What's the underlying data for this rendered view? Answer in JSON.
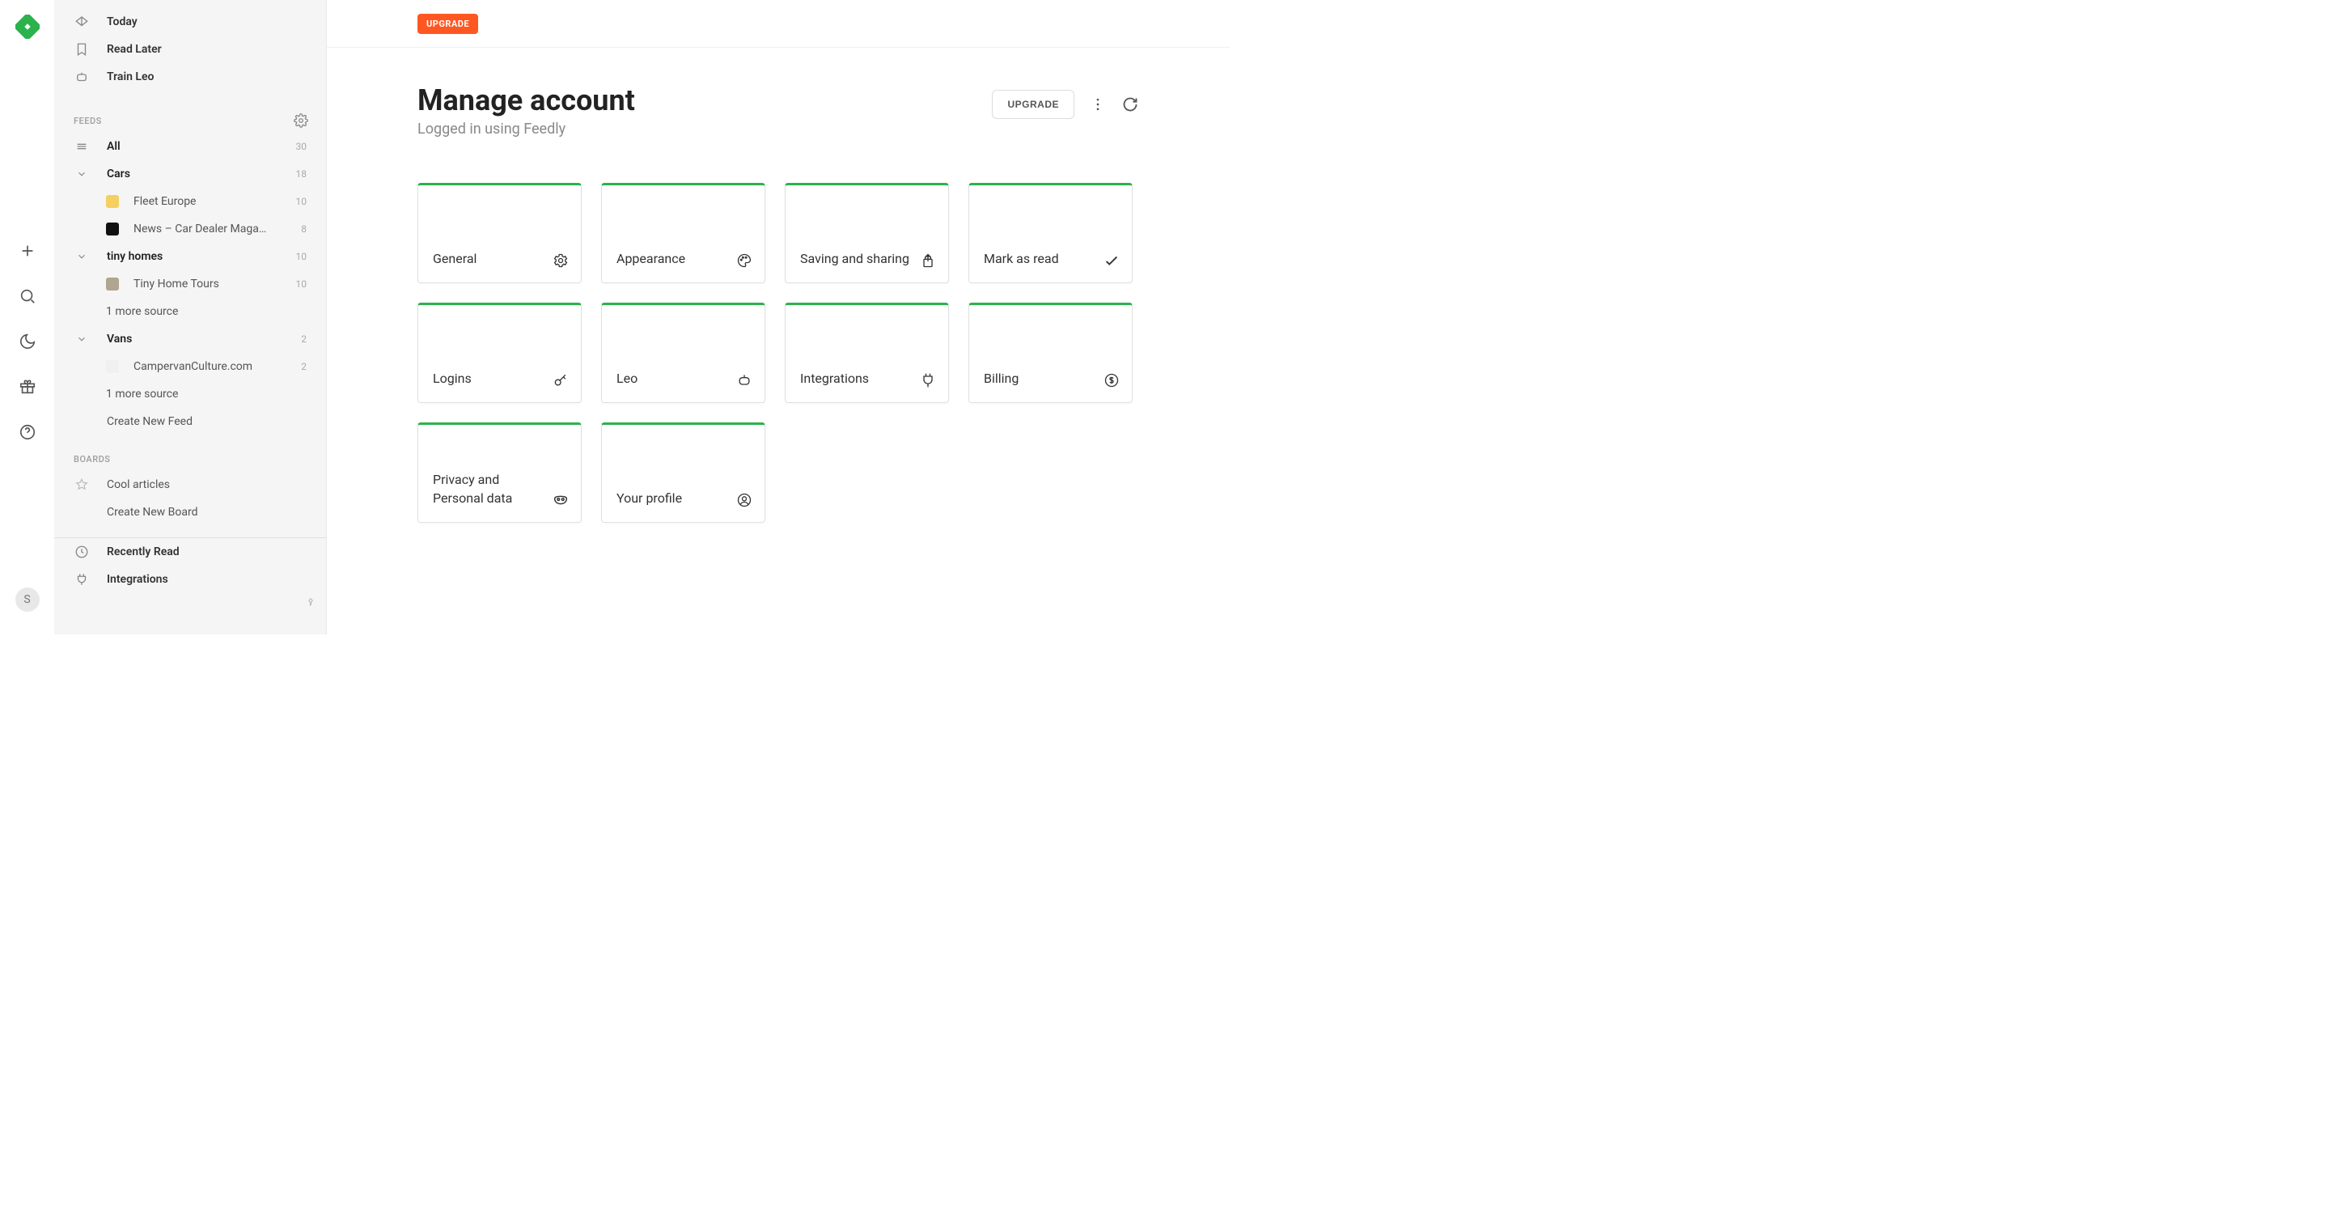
{
  "rail": {
    "avatar_letter": "S"
  },
  "sidebar": {
    "nav": {
      "today": "Today",
      "read_later": "Read Later",
      "train_leo": "Train Leo"
    },
    "feeds_label": "FEEDS",
    "all": {
      "label": "All",
      "count": "30"
    },
    "folders": [
      {
        "name": "Cars",
        "count": "18",
        "sources": [
          {
            "name": "Fleet Europe",
            "count": "10",
            "color": "#f5d060"
          },
          {
            "name": "News – Car Dealer Maga…",
            "count": "8",
            "color": "#111"
          }
        ],
        "more": null
      },
      {
        "name": "tiny homes",
        "count": "10",
        "sources": [
          {
            "name": "Tiny Home Tours",
            "count": "10",
            "color": "#b0a590"
          }
        ],
        "more": "1 more source"
      },
      {
        "name": "Vans",
        "count": "2",
        "sources": [
          {
            "name": "CampervanCulture.com",
            "count": "2",
            "color": "#f0f0f0"
          }
        ],
        "more": "1 more source"
      }
    ],
    "create_feed": "Create New Feed",
    "boards_label": "BOARDS",
    "boards": [
      {
        "name": "Cool articles"
      }
    ],
    "create_board": "Create New Board",
    "recently_read": "Recently Read",
    "integrations": "Integrations"
  },
  "header": {
    "upgrade_pill": "UPGRADE",
    "title": "Manage account",
    "subtitle": "Logged in using Feedly",
    "upgrade_button": "UPGRADE"
  },
  "cards": [
    {
      "label": "General",
      "icon": "gear"
    },
    {
      "label": "Appearance",
      "icon": "palette"
    },
    {
      "label": "Saving and sharing",
      "icon": "share"
    },
    {
      "label": "Mark as read",
      "icon": "check"
    },
    {
      "label": "Logins",
      "icon": "key"
    },
    {
      "label": "Leo",
      "icon": "bot"
    },
    {
      "label": "Integrations",
      "icon": "plug"
    },
    {
      "label": "Billing",
      "icon": "dollar"
    },
    {
      "label": "Privacy and Personal data",
      "icon": "mask"
    },
    {
      "label": "Your profile",
      "icon": "person"
    }
  ]
}
